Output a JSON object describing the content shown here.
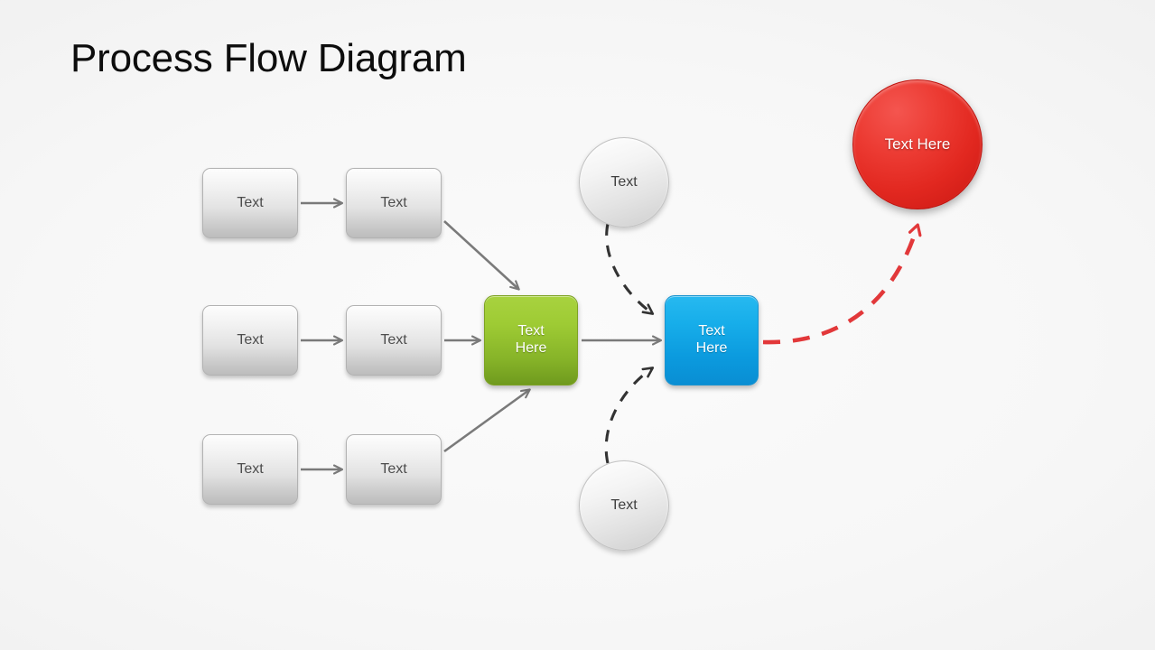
{
  "title": "Process Flow Diagram",
  "colors": {
    "background": "#f5f5f5",
    "grey_box": "#d9d9d9",
    "green": "#9ecb34",
    "blue": "#17aeea",
    "red": "#e22820",
    "connector_grey": "#7a7a7a",
    "connector_dashed": "#333333",
    "connector_red": "#e2383a",
    "title_text": "#0d0d0d"
  },
  "nodes": {
    "row1_box1": {
      "label": "Text"
    },
    "row1_box2": {
      "label": "Text"
    },
    "row2_box1": {
      "label": "Text"
    },
    "row2_box2": {
      "label": "Text"
    },
    "row3_box1": {
      "label": "Text"
    },
    "row3_box2": {
      "label": "Text"
    },
    "green_box": {
      "line1": "Text",
      "line2": "Here"
    },
    "blue_box": {
      "line1": "Text",
      "line2": "Here"
    },
    "circle_top": {
      "label": "Text"
    },
    "circle_bottom": {
      "label": "Text"
    },
    "circle_red": {
      "label": "Text Here"
    }
  },
  "connectors": [
    {
      "name": "row1-box1-to-box2",
      "style": "solid",
      "color": "#7a7a7a"
    },
    {
      "name": "row2-box1-to-box2",
      "style": "solid",
      "color": "#7a7a7a"
    },
    {
      "name": "row3-box1-to-box2",
      "style": "solid",
      "color": "#7a7a7a"
    },
    {
      "name": "row1-box2-to-green",
      "style": "solid",
      "color": "#7a7a7a"
    },
    {
      "name": "row2-box2-to-green",
      "style": "solid",
      "color": "#7a7a7a"
    },
    {
      "name": "row3-box2-to-green",
      "style": "solid",
      "color": "#7a7a7a"
    },
    {
      "name": "green-to-blue",
      "style": "solid",
      "color": "#7a7a7a"
    },
    {
      "name": "circle-top-to-blue",
      "style": "dashed",
      "color": "#333333"
    },
    {
      "name": "circle-bottom-to-blue",
      "style": "dashed",
      "color": "#333333"
    },
    {
      "name": "blue-to-red-circle",
      "style": "dashed",
      "color": "#e2383a"
    }
  ]
}
